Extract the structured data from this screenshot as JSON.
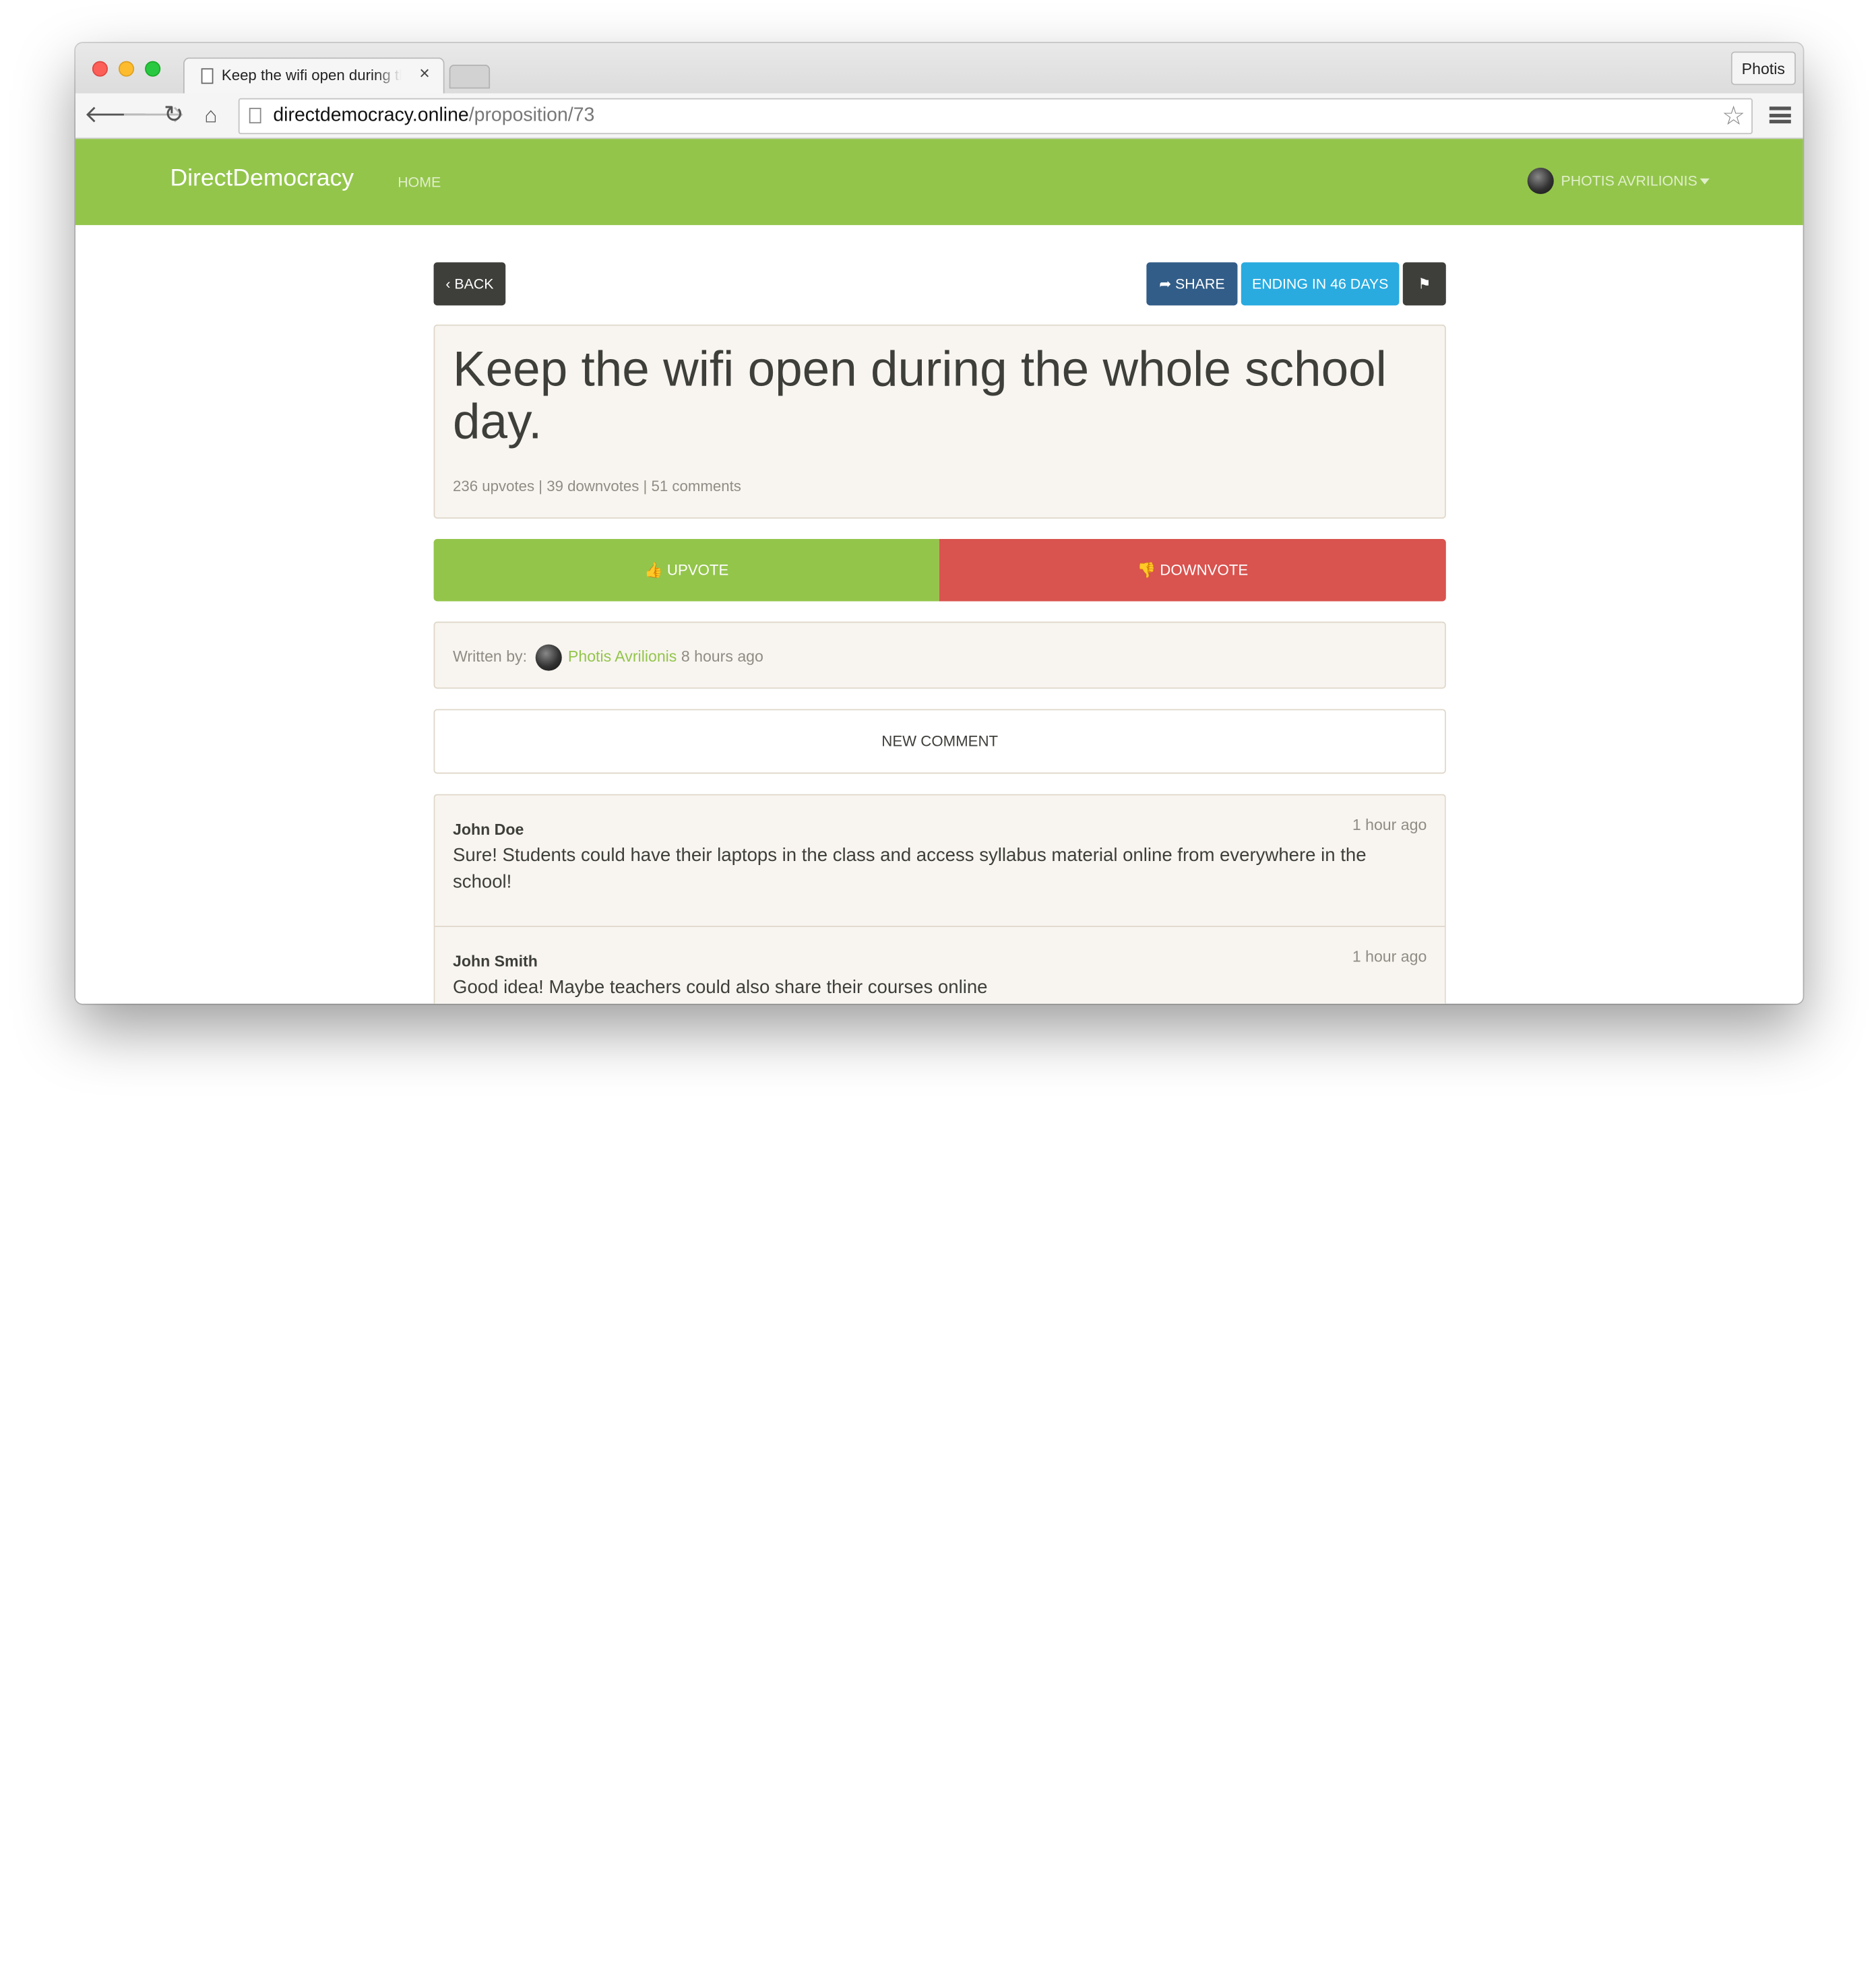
{
  "browser": {
    "tab_title": "Keep the wifi open during the whole school day.",
    "tab_close": "×",
    "profile": "Photis",
    "url_host": "directdemocracy.online",
    "url_path": "/proposition/73",
    "back_glyph": "🡐",
    "forward_glyph": "🡒",
    "reload_glyph": "↻",
    "home_glyph": "⌂",
    "star_glyph": "☆"
  },
  "navbar": {
    "brand": "DirectDemocracy",
    "home": "HOME",
    "user": "PHOTIS AVRILIONIS"
  },
  "actions": {
    "back": "‹ BACK",
    "share": "➦ SHARE",
    "ending": "ENDING IN 46 DAYS",
    "flag": "⚑"
  },
  "proposition": {
    "title": "Keep the wifi open during the whole school day.",
    "stats": "236 upvotes | 39 downvotes | 51 comments",
    "upvotes": 236,
    "downvotes": 39,
    "comment_count": 51
  },
  "vote": {
    "upvote": "👍 UPVOTE",
    "downvote": "👎 DOWNVOTE"
  },
  "author": {
    "prefix": "Written by:",
    "name": "Photis Avrilionis",
    "time": "8 hours ago"
  },
  "new_comment": "NEW COMMENT",
  "comments": [
    {
      "author": "John Doe",
      "time": "1 hour ago",
      "text": "Sure! Students could have their laptops in the class and access syllabus material online from everywhere in the school!"
    },
    {
      "author": "John Smith",
      "time": "1 hour ago",
      "text": "Good idea! Maybe teachers could also share their courses online"
    }
  ],
  "colors": {
    "nav_green": "#93c54b",
    "upvote": "#93c54b",
    "downvote": "#d9534f",
    "share": "#325d88",
    "ending": "#29abe0",
    "dark": "#3e3f3a"
  }
}
